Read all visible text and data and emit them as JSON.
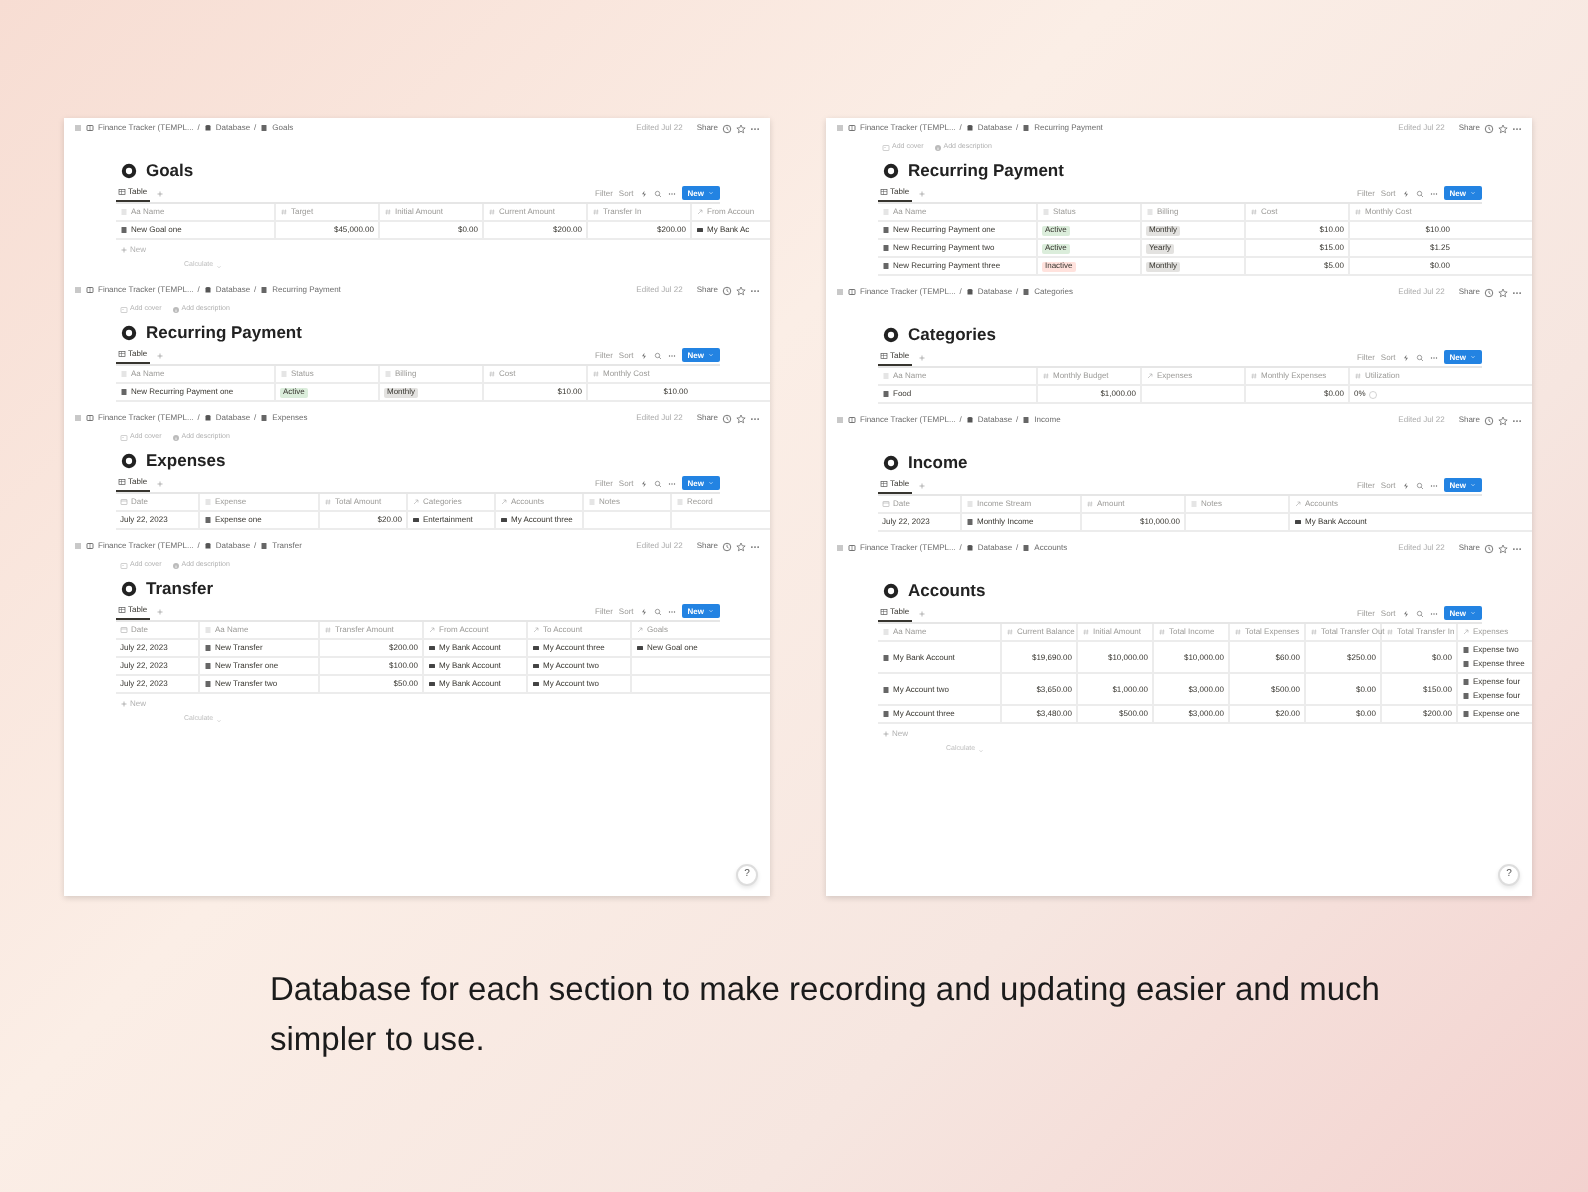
{
  "panels": [
    {
      "sections": [
        {
          "breadcrumb": [
            "Finance Tracker (TEMPL...",
            "/",
            "Database",
            "/",
            "Goals"
          ],
          "edited": "Edited Jul 22",
          "share": "Share",
          "title": "Goals",
          "view_tab": "Table",
          "toolbar": [
            "Filter",
            "Sort"
          ],
          "new_button": "New",
          "columns": [
            {
              "label": "Aa Name",
              "kind": "name"
            },
            {
              "label": "Target",
              "kind": "number"
            },
            {
              "label": "Initial Amount",
              "kind": "number"
            },
            {
              "label": "Current Amount",
              "kind": "number"
            },
            {
              "label": "Transfer In",
              "kind": "number"
            },
            {
              "label": "From Accoun",
              "kind": "relation"
            }
          ],
          "rows": [
            [
              "New Goal one",
              "$45,000.00",
              "$0.00",
              "$200.00",
              "$200.00",
              "My Bank Ac"
            ]
          ],
          "new_row": "New",
          "calculate": "Calculate"
        },
        {
          "breadcrumb": [
            "Finance Tracker (TEMPL...",
            "/",
            "Database",
            "/",
            "Recurring Payment"
          ],
          "edited": "Edited Jul 22",
          "share": "Share",
          "cover_links": [
            "Add cover",
            "Add description"
          ],
          "title": "Recurring Payment",
          "view_tab": "Table",
          "toolbar": [
            "Filter",
            "Sort"
          ],
          "new_button": "New",
          "columns": [
            {
              "label": "Aa Name",
              "kind": "name"
            },
            {
              "label": "Status",
              "kind": "tag"
            },
            {
              "label": "Billing",
              "kind": "tag"
            },
            {
              "label": "Cost",
              "kind": "number"
            },
            {
              "label": "Monthly Cost",
              "kind": "number"
            }
          ],
          "rows": [
            [
              "New Recurring Payment one",
              {
                "text": "Active",
                "color": "#dbeddb"
              },
              {
                "text": "Monthly",
                "color": "#e3e2e0"
              },
              "$10.00",
              "$10.00"
            ]
          ]
        },
        {
          "breadcrumb": [
            "Finance Tracker (TEMPL...",
            "/",
            "Database",
            "/",
            "Expenses"
          ],
          "edited": "Edited Jul 22",
          "share": "Share",
          "cover_links": [
            "Add cover",
            "Add description"
          ],
          "title": "Expenses",
          "view_tab": "Table",
          "toolbar": [
            "Filter",
            "Sort"
          ],
          "new_button": "New",
          "columns": [
            {
              "label": "Date",
              "kind": "date"
            },
            {
              "label": "Expense",
              "kind": "name"
            },
            {
              "label": "Total Amount",
              "kind": "number"
            },
            {
              "label": "Categories",
              "kind": "relation"
            },
            {
              "label": "Accounts",
              "kind": "relation"
            },
            {
              "label": "Notes",
              "kind": "text"
            },
            {
              "label": "Record",
              "kind": "text"
            }
          ],
          "rows": [
            [
              "July 22, 2023",
              "Expense one",
              "$20.00",
              "Entertainment",
              "My Account three",
              null,
              null
            ]
          ]
        },
        {
          "breadcrumb": [
            "Finance Tracker (TEMPL...",
            "/",
            "Database",
            "/",
            "Transfer"
          ],
          "edited": "Edited Jul 22",
          "share": "Share",
          "cover_links": [
            "Add cover",
            "Add description"
          ],
          "title": "Transfer",
          "view_tab": "Table",
          "toolbar": [
            "Filter",
            "Sort"
          ],
          "new_button": "New",
          "columns": [
            {
              "label": "Date",
              "kind": "date"
            },
            {
              "label": "Aa Name",
              "kind": "name"
            },
            {
              "label": "Transfer Amount",
              "kind": "number"
            },
            {
              "label": "From Account",
              "kind": "relation"
            },
            {
              "label": "To Account",
              "kind": "relation"
            },
            {
              "label": "Goals",
              "kind": "relation"
            }
          ],
          "rows": [
            [
              "July 22, 2023",
              "New Transfer",
              "$200.00",
              "My Bank Account",
              "My Account three",
              "New Goal one"
            ],
            [
              "July 22, 2023",
              "New Transfer one",
              "$100.00",
              "My Bank Account",
              "My Account two",
              null
            ],
            [
              "July 22, 2023",
              "New Transfer two",
              "$50.00",
              "My Bank Account",
              "My Account two",
              null
            ]
          ],
          "new_row": "New",
          "calculate": "Calculate"
        }
      ],
      "help": "?"
    },
    {
      "sections": [
        {
          "breadcrumb": [
            "Finance Tracker (TEMPL...",
            "/",
            "Database",
            "/",
            "Recurring Payment"
          ],
          "edited": "Edited Jul 22",
          "share": "Share",
          "cover_links": [
            "Add cover",
            "Add description"
          ],
          "title": "Recurring Payment",
          "view_tab": "Table",
          "toolbar": [
            "Filter",
            "Sort"
          ],
          "new_button": "New",
          "columns": [
            {
              "label": "Aa Name",
              "kind": "name"
            },
            {
              "label": "Status",
              "kind": "tag"
            },
            {
              "label": "Billing",
              "kind": "tag"
            },
            {
              "label": "Cost",
              "kind": "number"
            },
            {
              "label": "Monthly Cost",
              "kind": "number"
            }
          ],
          "rows": [
            [
              "New Recurring Payment one",
              {
                "text": "Active",
                "color": "#dbeddb"
              },
              {
                "text": "Monthly",
                "color": "#e3e2e0"
              },
              "$10.00",
              "$10.00"
            ],
            [
              "New Recurring Payment two",
              {
                "text": "Active",
                "color": "#dbeddb"
              },
              {
                "text": "Yearly",
                "color": "#e3e2e0"
              },
              "$15.00",
              "$1.25"
            ],
            [
              "New Recurring Payment three",
              {
                "text": "Inactive",
                "color": "#ffe2dd"
              },
              {
                "text": "Monthly",
                "color": "#e3e2e0"
              },
              "$5.00",
              "$0.00"
            ]
          ]
        },
        {
          "breadcrumb": [
            "Finance Tracker (TEMPL...",
            "/",
            "Database",
            "/",
            "Categories"
          ],
          "edited": "Edited Jul 22",
          "share": "Share",
          "title": "Categories",
          "view_tab": "Table",
          "toolbar": [
            "Filter",
            "Sort"
          ],
          "new_button": "New",
          "columns": [
            {
              "label": "Aa Name",
              "kind": "name"
            },
            {
              "label": "Monthly Budget",
              "kind": "number"
            },
            {
              "label": "Expenses",
              "kind": "relation"
            },
            {
              "label": "Monthly Expenses",
              "kind": "number"
            },
            {
              "label": "Utilization",
              "kind": "progress"
            }
          ],
          "rows": [
            [
              "Food",
              "$1,000.00",
              null,
              "$0.00",
              "0%"
            ]
          ]
        },
        {
          "breadcrumb": [
            "Finance Tracker (TEMPL...",
            "/",
            "Database",
            "/",
            "Income"
          ],
          "edited": "Edited Jul 22",
          "share": "Share",
          "title": "Income",
          "view_tab": "Table",
          "toolbar": [
            "Filter",
            "Sort"
          ],
          "new_button": "New",
          "columns": [
            {
              "label": "Date",
              "kind": "date"
            },
            {
              "label": "Income Stream",
              "kind": "name"
            },
            {
              "label": "Amount",
              "kind": "number"
            },
            {
              "label": "Notes",
              "kind": "text"
            },
            {
              "label": "Accounts",
              "kind": "relation"
            }
          ],
          "rows": [
            [
              "July 22, 2023",
              "Monthly Income",
              "$10,000.00",
              null,
              "My Bank Account"
            ]
          ]
        },
        {
          "breadcrumb": [
            "Finance Tracker (TEMPL...",
            "/",
            "Database",
            "/",
            "Accounts"
          ],
          "edited": "Edited Jul 22",
          "share": "Share",
          "title": "Accounts",
          "view_tab": "Table",
          "toolbar": [
            "Filter",
            "Sort"
          ],
          "new_button": "New",
          "columns": [
            {
              "label": "Aa Name",
              "kind": "name"
            },
            {
              "label": "Current Balance",
              "kind": "number"
            },
            {
              "label": "Initial Amount",
              "kind": "number"
            },
            {
              "label": "Total Income",
              "kind": "number"
            },
            {
              "label": "Total Expenses",
              "kind": "number"
            },
            {
              "label": "Total Transfer Out",
              "kind": "number"
            },
            {
              "label": "Total Transfer In",
              "kind": "number"
            },
            {
              "label": "Expenses",
              "kind": "relation"
            }
          ],
          "rows": [
            [
              "My Bank Account",
              "$19,690.00",
              "$10,000.00",
              "$10,000.00",
              "$60.00",
              "$250.00",
              "$0.00",
              [
                "Expense two",
                "Expense three"
              ]
            ],
            [
              "My Account two",
              "$3,650.00",
              "$1,000.00",
              "$3,000.00",
              "$500.00",
              "$0.00",
              "$150.00",
              [
                "Expense four",
                "Expense four"
              ]
            ],
            [
              "My Account three",
              "$3,480.00",
              "$500.00",
              "$3,000.00",
              "$20.00",
              "$0.00",
              "$200.00",
              [
                "Expense one"
              ]
            ]
          ],
          "new_row": "New",
          "calculate": "Calculate"
        }
      ],
      "help": "?"
    }
  ],
  "caption": "Database for each section to make recording and updating easier and much simpler to use."
}
